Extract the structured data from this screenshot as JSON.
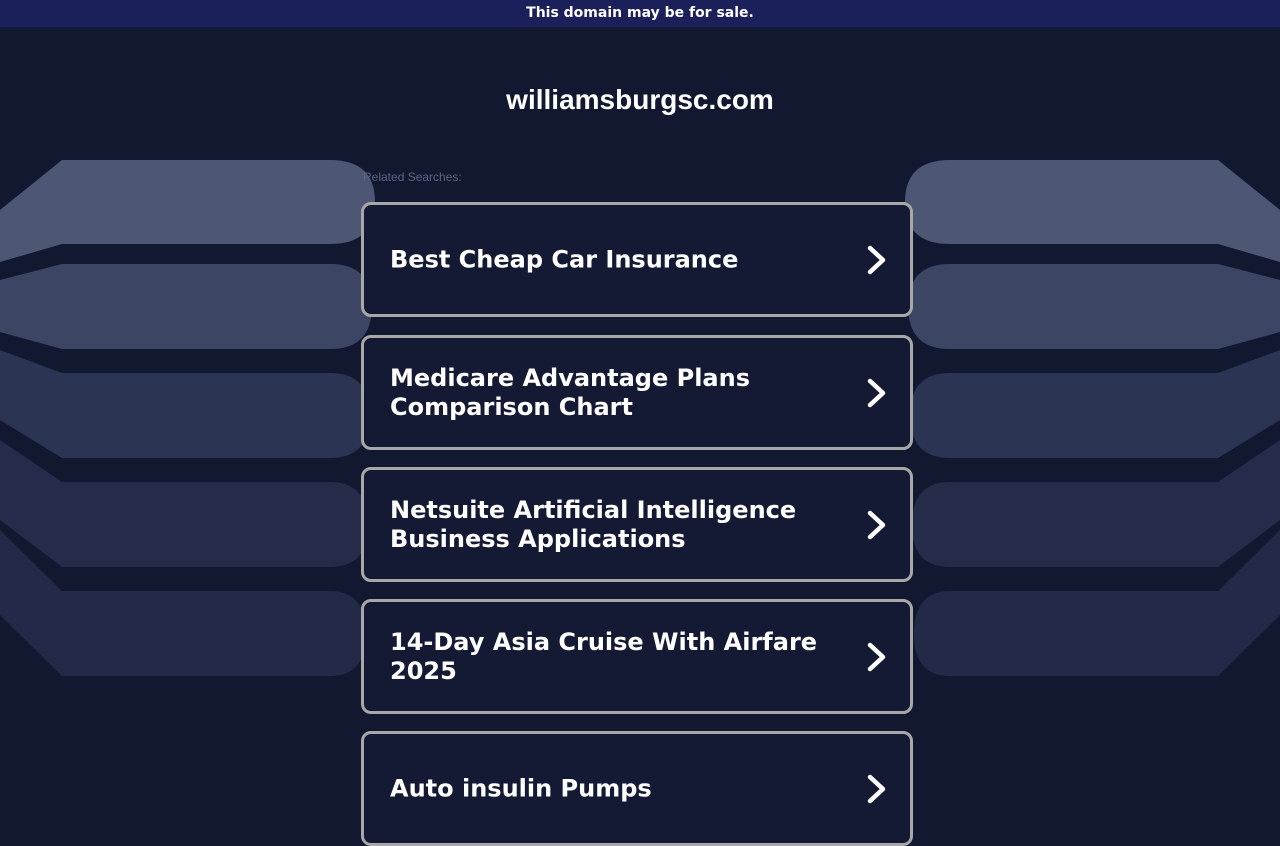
{
  "banner": {
    "text": "This domain may be for sale."
  },
  "site": {
    "domain": "williamsburgsc.com"
  },
  "related": {
    "label": "Related Searches:",
    "items": [
      {
        "label": "Best Cheap Car Insurance"
      },
      {
        "label": "Medicare Advantage Plans Comparison Chart"
      },
      {
        "label": "Netsuite Artificial Intelligence Business Applications"
      },
      {
        "label": "14-Day Asia Cruise With Airfare 2025"
      },
      {
        "label": "Auto insulin Pumps"
      }
    ]
  },
  "icons": {
    "card_arrow": "chevron-right-icon"
  },
  "colors": {
    "background": "#121830",
    "banner": "#1b1f5a",
    "card_border": "#a8a8a8",
    "text": "#ffffff"
  }
}
